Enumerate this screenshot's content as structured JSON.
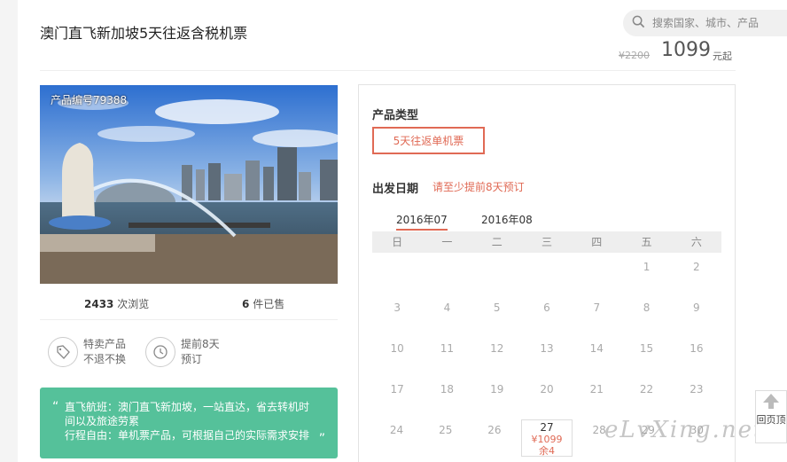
{
  "header": {
    "title": "澳门直飞新加坡5天往返含税机票",
    "search_placeholder": "搜索国家、城市、产品",
    "price_old": "¥2200",
    "price_new": "1099",
    "price_unit": "元起"
  },
  "photo": {
    "product_id": "产品编号79388"
  },
  "stats": {
    "views_num": "2433",
    "views_label": "次浏览",
    "sold_num": "6",
    "sold_label": "件已售"
  },
  "features": [
    {
      "line1": "特卖产品",
      "line2": "不退不换"
    },
    {
      "line1": "提前8天",
      "line2": "预订"
    }
  ],
  "promo": {
    "lines": [
      "直飞航班：澳门直飞新加坡，一站直达，省去转机时",
      "间以及旅途劳累",
      "行程自由：单机票产品，可根据自己的实际需求安排"
    ]
  },
  "booking": {
    "type_label": "产品类型",
    "type_option": "5天往返单机票",
    "date_label": "出发日期",
    "date_note": "请至少提前8天预订",
    "months": [
      "2016年07",
      "2016年08"
    ],
    "weekdays": [
      "日",
      "一",
      "二",
      "三",
      "四",
      "五",
      "六"
    ],
    "selected": {
      "day": "27",
      "price": "¥1099",
      "stock": "余4"
    }
  },
  "calendar_rows": [
    [
      "",
      "",
      "",
      "",
      "",
      "1",
      "2"
    ],
    [
      "3",
      "4",
      "5",
      "6",
      "7",
      "8",
      "9"
    ],
    [
      "10",
      "11",
      "12",
      "13",
      "14",
      "15",
      "16"
    ],
    [
      "17",
      "18",
      "19",
      "20",
      "21",
      "22",
      "23"
    ],
    [
      "24",
      "25",
      "26",
      "27",
      "28",
      "29",
      "30"
    ]
  ],
  "watermark": "eLvXing.net",
  "back_top": "回页顶"
}
